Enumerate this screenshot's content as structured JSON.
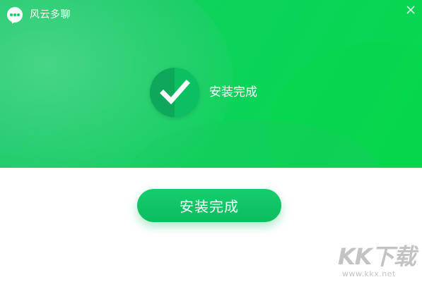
{
  "window": {
    "title": "风云多聊",
    "close_label": "×"
  },
  "banner": {
    "status_text": "安装完成",
    "status_icon": "checkmark-icon"
  },
  "actions": {
    "finish_label": "安装完成"
  },
  "watermark": {
    "logo": "KK下载",
    "url": "www.kkx.net"
  },
  "colors": {
    "primary_green": "#0fd05f",
    "button_green": "#12c867",
    "text_white": "#ffffff"
  }
}
